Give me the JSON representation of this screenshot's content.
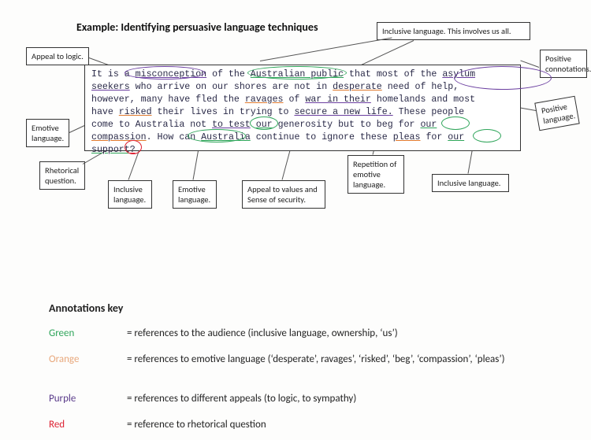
{
  "title": "Example: Identifying persuasive language techniques",
  "passage": {
    "line1a": "It is a ",
    "line1b": "misconception",
    "line1c": " of the ",
    "line1d": "Australian public",
    "line1e": " that most of the ",
    "line1f": "asylum",
    "line2a": "seekers",
    "line2b": " who arrive on our shores are not in ",
    "line2c": "desperate",
    "line2d": " need of help,",
    "line3a": "however, many have fled the ",
    "line3b": "ravages",
    "line3c": " of ",
    "line3d": "war in their",
    "line3e": " homelands and most",
    "line4a": "have ",
    "line4b": "risked",
    "line4c": " their lives in trying to ",
    "line4d": "secure a new life.",
    "line4e": " These people",
    "line5a": "come to Australia not ",
    "line5b": "to test",
    "line5c": " ",
    "line5d": "our",
    "line5e": " generosity but to beg for ",
    "line5f": "our",
    "line6a": "compassion",
    "line6b": ". How can ",
    "line6c": "Australia",
    "line6d": " continue to ignore these ",
    "line6e": "pleas",
    "line6f": " for ",
    "line6g": "our",
    "line7a": "support",
    "line7b": "?"
  },
  "ann": {
    "appeal_logic": "Appeal to logic.",
    "inclusive_top": "Inclusive language. This involves us all.",
    "positive_conn": "Positive connotations.",
    "positive_lang": "Positive language.",
    "emotive_left": "Emotive language.",
    "rhetorical": "Rhetorical question.",
    "inclusive_bottom": "Inclusive language.",
    "emotive_bottom": "Emotive language.",
    "appeal_values": "Appeal to values and Sense of security.",
    "repetition": "Repetition of emotive language.",
    "inclusive_right": "Inclusive language."
  },
  "key": {
    "title": "Annotations key",
    "rows": [
      {
        "label": "Green",
        "class": "kl-green",
        "text": "= references to the audience (inclusive language, ownership, ‘us’)"
      },
      {
        "label": "Orange",
        "class": "kl-orange",
        "text": "= references to emotive language (‘desperate’, ravages’, ‘risked’, ‘beg’, ‘compassion’, ‘pleas’)"
      },
      {
        "label": "Purple",
        "class": "kl-purple",
        "text": "= references to different appeals (to logic, to sympathy)"
      },
      {
        "label": "Red",
        "class": "kl-red",
        "text": "= reference to rhetorical question"
      }
    ]
  }
}
